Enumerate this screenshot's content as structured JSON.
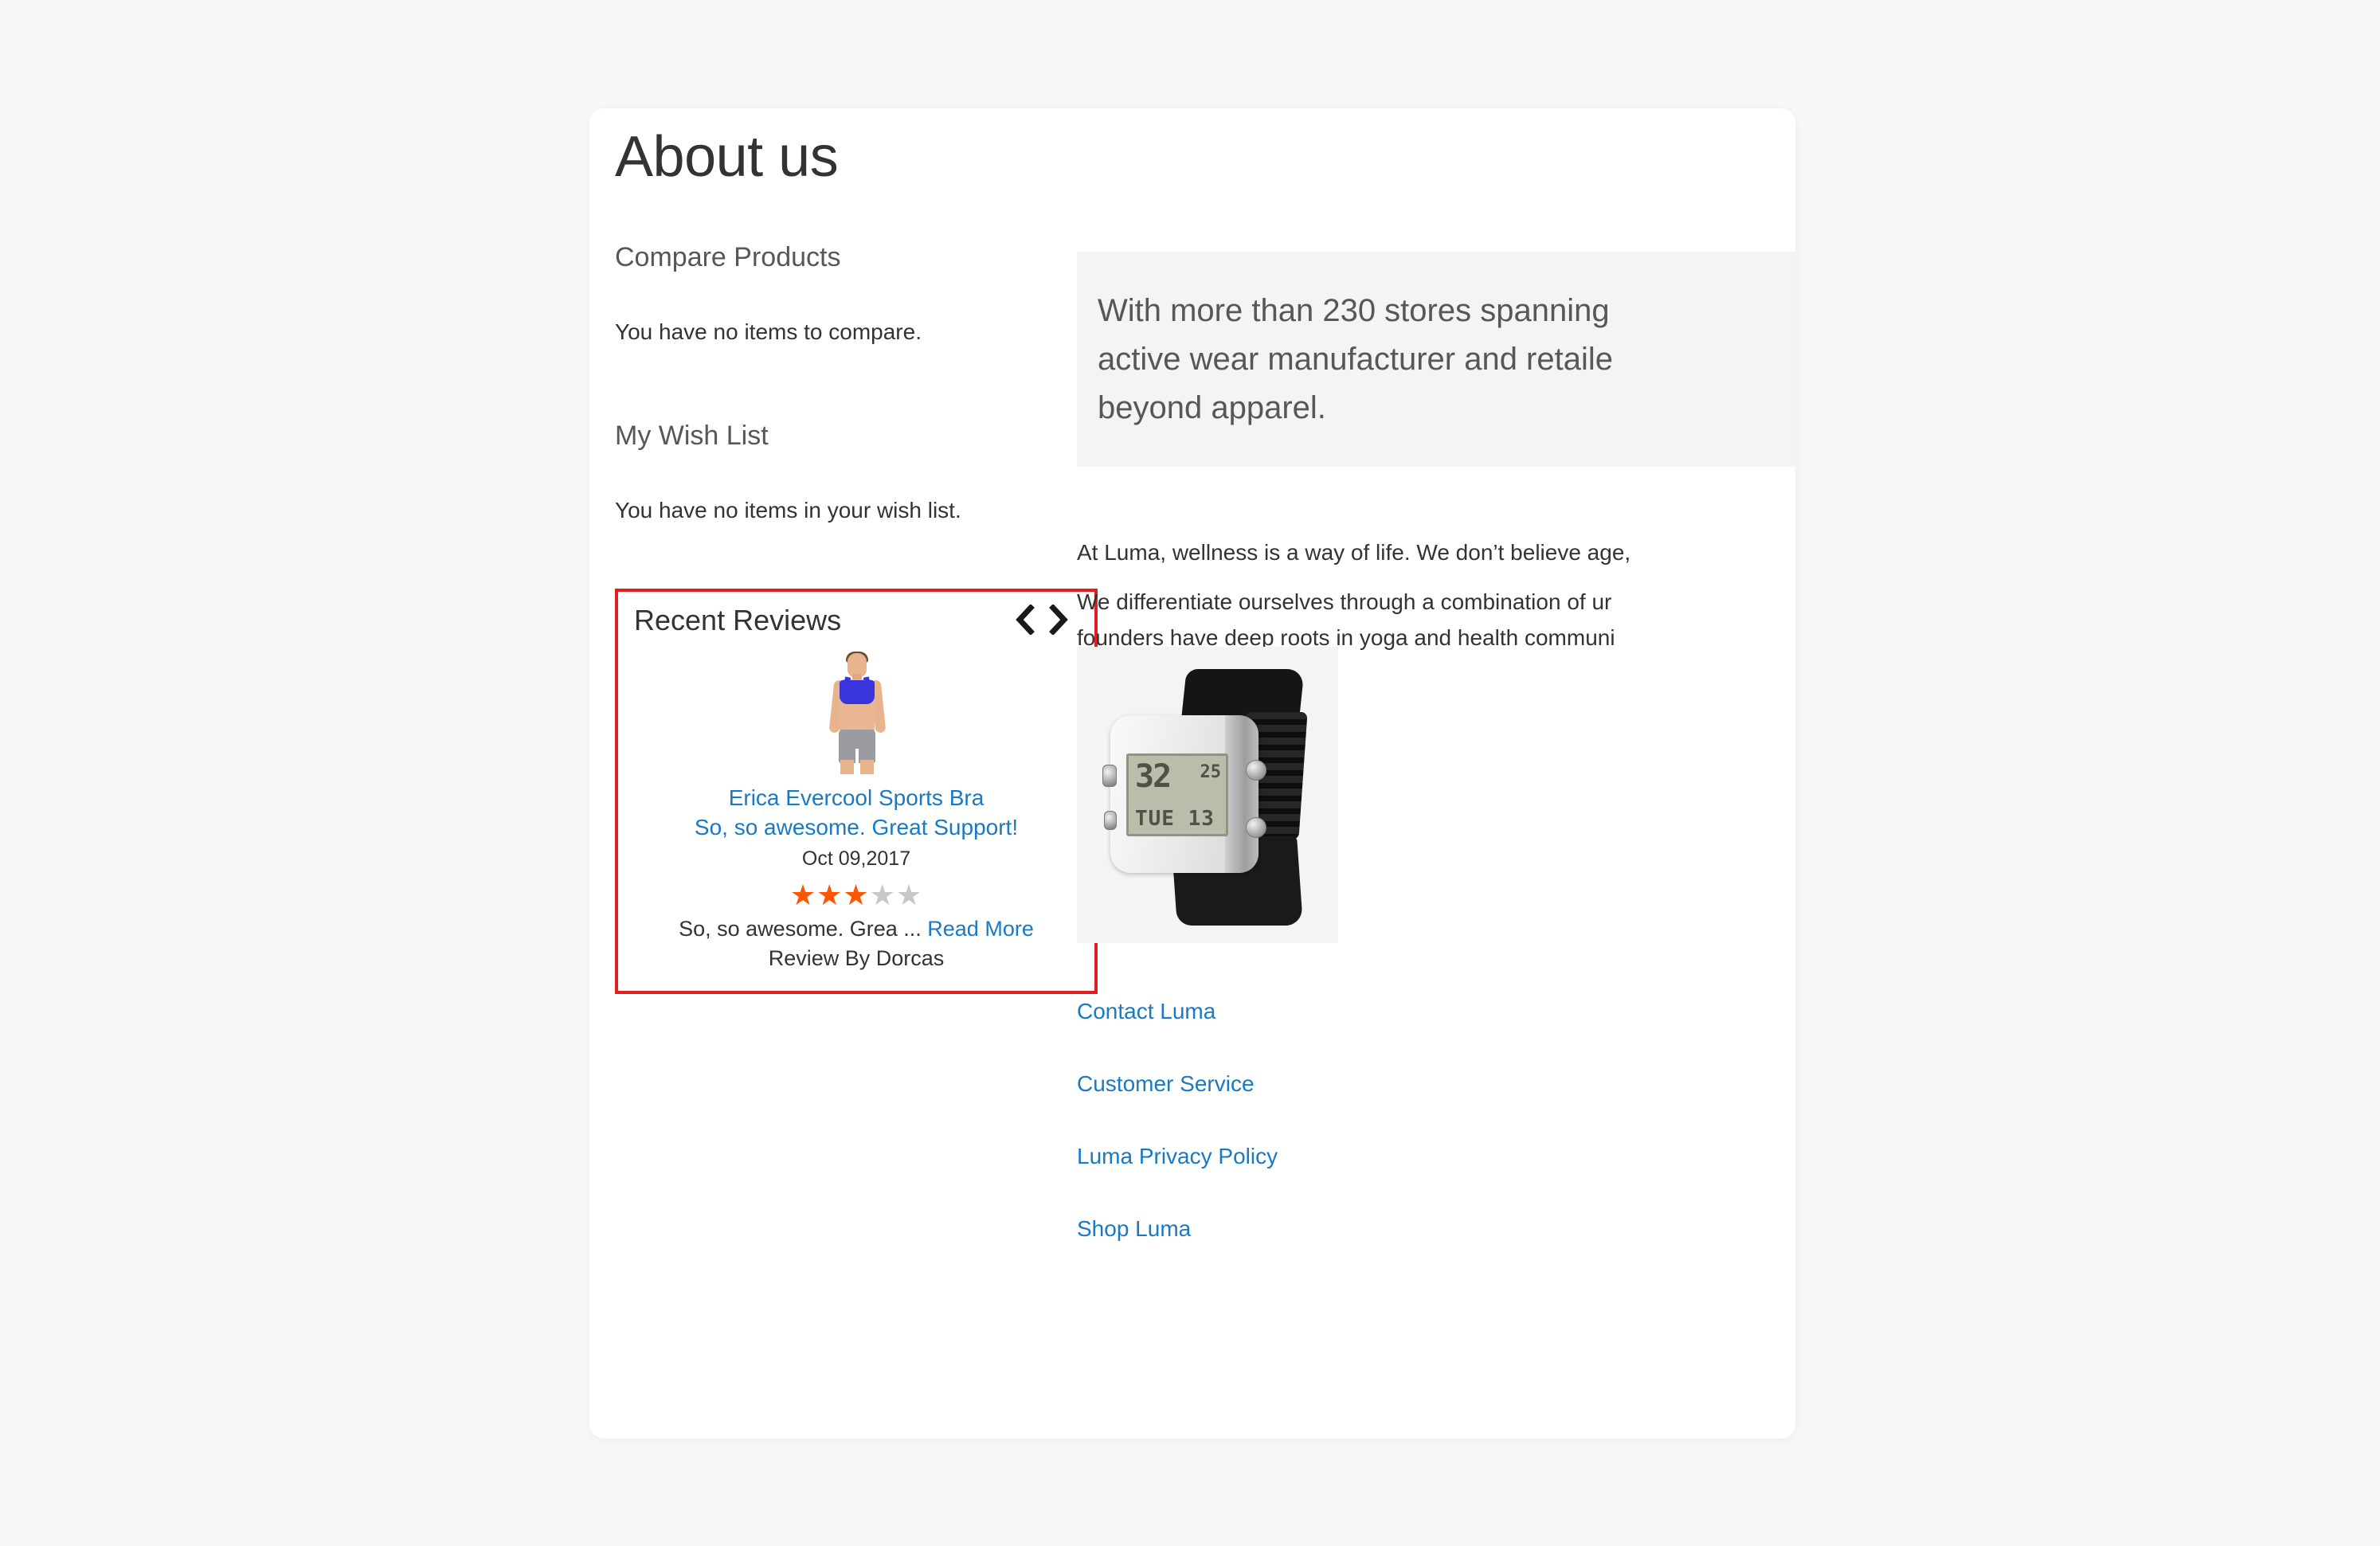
{
  "page": {
    "title": "About us"
  },
  "sidebar": {
    "compare": {
      "title": "Compare Products",
      "empty": "You have no items to compare."
    },
    "wishlist": {
      "title": "My Wish List",
      "empty": "You have no items in your wish list."
    },
    "recent_reviews": {
      "title": "Recent Reviews",
      "prev_icon": "chevron-left-icon",
      "next_icon": "chevron-right-icon",
      "item": {
        "product_image": "erica-evercool-sports-bra-thumbnail",
        "product_name": "Erica Evercool Sports Bra",
        "review_title": "So, so awesome. Great Support!",
        "date": "Oct 09,2017",
        "rating": 3,
        "rating_max": 5,
        "excerpt": "So, so awesome. Grea ...",
        "read_more": "Read More",
        "reviewer": "Review By Dorcas"
      }
    }
  },
  "main": {
    "quote": [
      "With more than 230 stores spanning",
      "active wear manufacturer and retaile",
      "beyond apparel."
    ],
    "paragraphs": [
      "At Luma, wellness is a way of life. We don’t believe age,",
      "We differentiate ourselves through a combination of ur",
      "founders have deep roots in yoga and health communi"
    ],
    "product_image": {
      "name": "digital-watch-product-image",
      "display_time": "32",
      "display_seconds": "25",
      "display_day": "TUE 13"
    },
    "links": [
      "Contact Luma",
      "Customer Service",
      "Luma Privacy Policy",
      "Shop Luma"
    ]
  },
  "colors": {
    "link": "#1979c3",
    "star_on": "#ff5501",
    "star_off": "#c7c7c7",
    "highlight_border": "#e02020",
    "quote_bg": "#f4f4f4",
    "page_bg": "#f7f7f7"
  },
  "stars": {
    "filled": "★★★",
    "empty": "★★"
  }
}
